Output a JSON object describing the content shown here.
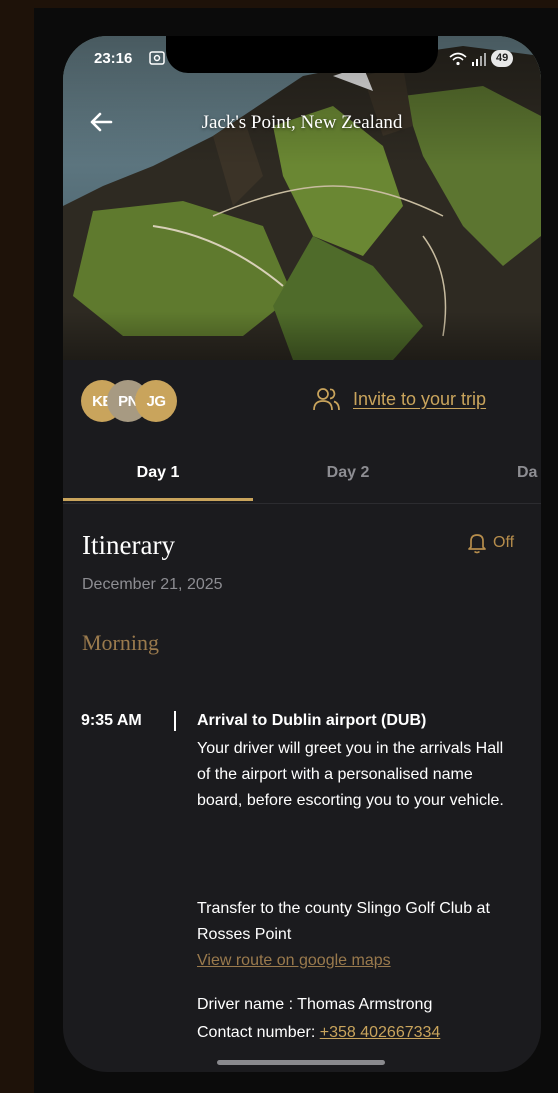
{
  "status_bar": {
    "time": "23:16",
    "battery": "49"
  },
  "header": {
    "title": "Jack's Point, New Zealand"
  },
  "travelers": [
    {
      "initials": "KE",
      "color": "#c9a45c"
    },
    {
      "initials": "PN",
      "color": "#a79a82"
    },
    {
      "initials": "JG",
      "color": "#c9a45c"
    }
  ],
  "invite": {
    "label": "Invite to your trip"
  },
  "tabs": [
    {
      "label": "Day 1",
      "active": true
    },
    {
      "label": "Day 2",
      "active": false
    },
    {
      "label": "Da",
      "active": false
    }
  ],
  "itinerary": {
    "title": "Itinerary",
    "notification": "Off",
    "date": "December 21, 2025",
    "section": "Morning",
    "entry": {
      "time": "9:35 AM",
      "title": "Arrival to Dublin airport (DUB)",
      "description": "Your driver will greet you in the arrivals Hall of the airport with a personalised name board, before escorting you to your vehicle.",
      "transfer": "Transfer to the county Slingo Golf Club at Rosses Point",
      "route_link": "View route on google maps",
      "driver": "Driver name : Thomas Armstrong",
      "contact_label": "Contact number: ",
      "contact_number": "+358 402667334"
    }
  },
  "colors": {
    "accent": "#c9a45c",
    "background": "#1b1b1e"
  }
}
